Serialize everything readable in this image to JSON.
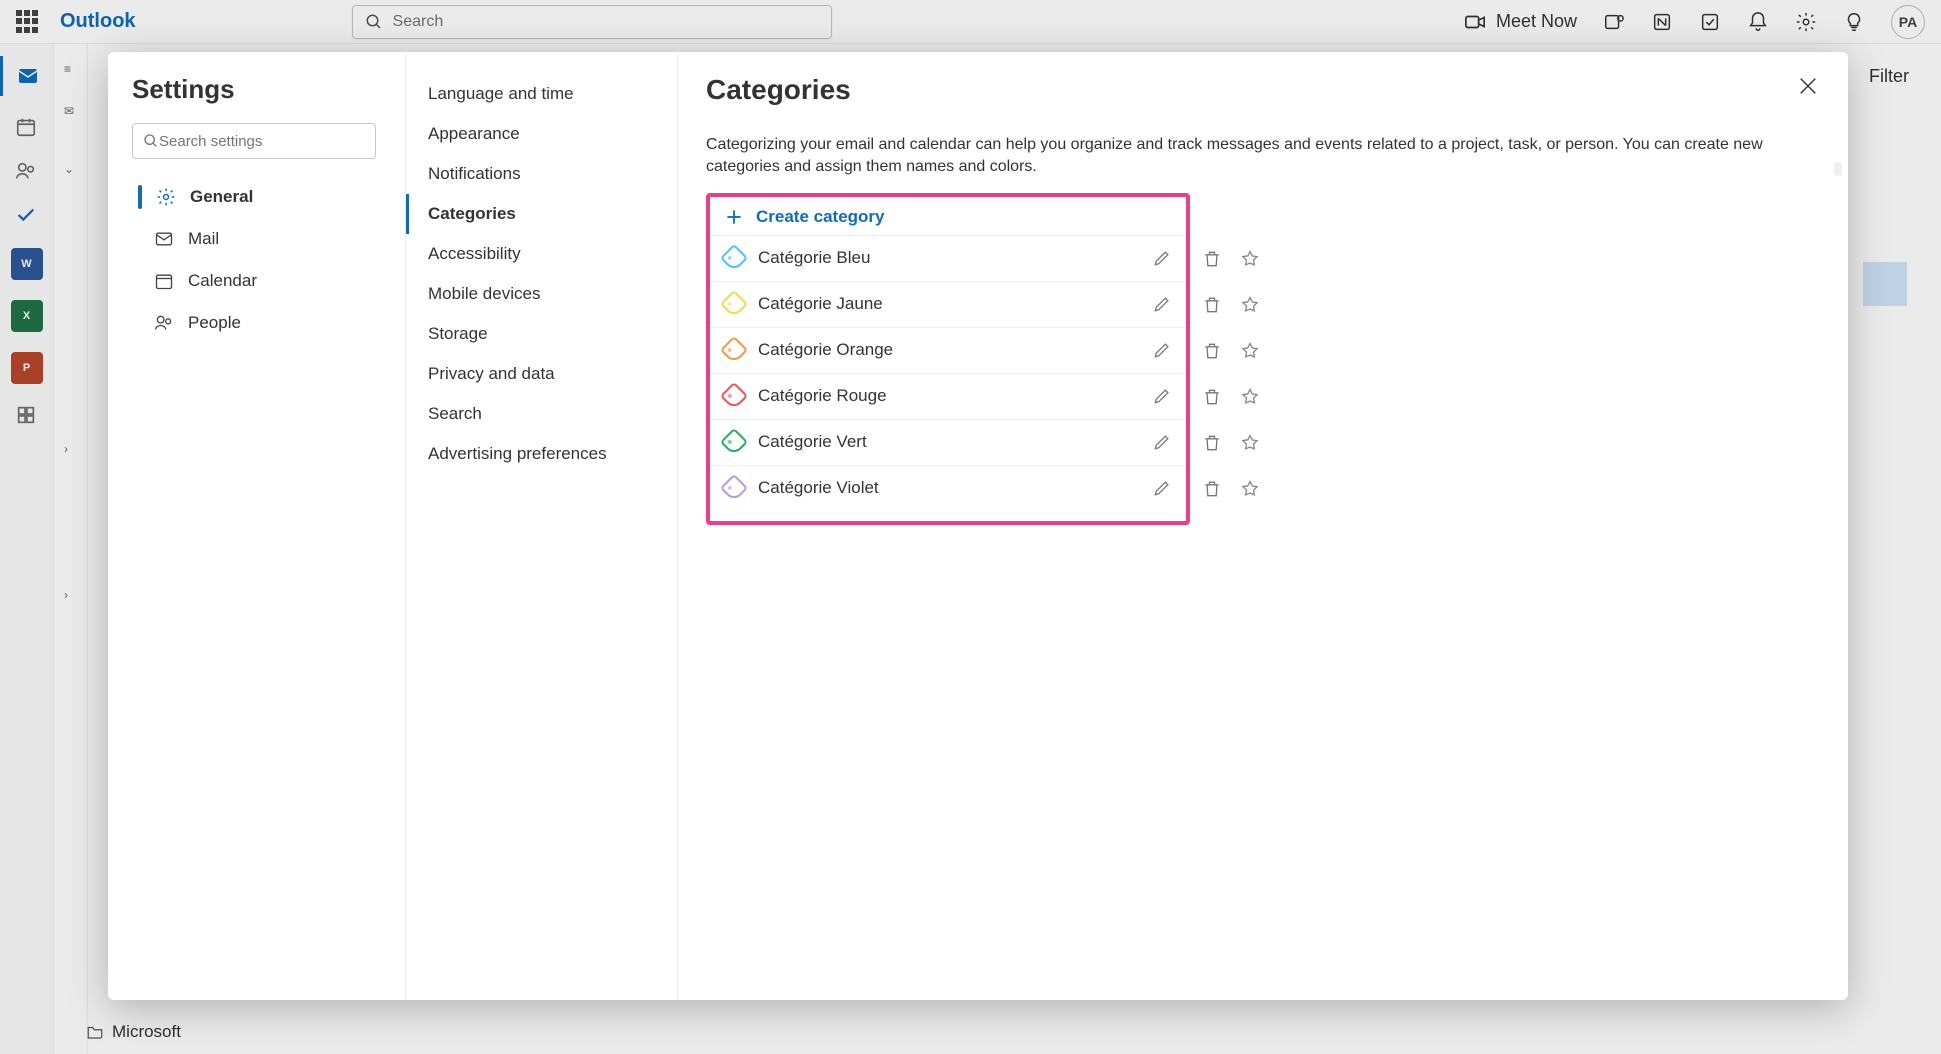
{
  "topbar": {
    "brand": "Outlook",
    "search_placeholder": "Search",
    "meet_now": "Meet Now",
    "avatar": "PA"
  },
  "mailbg": {
    "filter": "Filter",
    "folder_microsoft": "Microsoft"
  },
  "settings": {
    "title": "Settings",
    "search_placeholder": "Search settings",
    "nav": [
      {
        "key": "general",
        "label": "General",
        "icon": "gear"
      },
      {
        "key": "mail",
        "label": "Mail",
        "icon": "mail"
      },
      {
        "key": "calendar",
        "label": "Calendar",
        "icon": "calendar"
      },
      {
        "key": "people",
        "label": "People",
        "icon": "people"
      }
    ],
    "nav_active": "general",
    "subnav": [
      "Language and time",
      "Appearance",
      "Notifications",
      "Categories",
      "Accessibility",
      "Mobile devices",
      "Storage",
      "Privacy and data",
      "Search",
      "Advertising preferences"
    ],
    "subnav_active": "Categories"
  },
  "panel": {
    "heading": "Categories",
    "description": "Categorizing your email and calendar can help you organize and track messages and events related to a project, task, or person. You can create new categories and assign them names and colors.",
    "create_label": "Create category",
    "categories": [
      {
        "name": "Catégorie Bleu",
        "color_class": "c-blue"
      },
      {
        "name": "Catégorie Jaune",
        "color_class": "c-yellow"
      },
      {
        "name": "Catégorie Orange",
        "color_class": "c-orange"
      },
      {
        "name": "Catégorie Rouge",
        "color_class": "c-red"
      },
      {
        "name": "Catégorie Vert",
        "color_class": "c-green"
      },
      {
        "name": "Catégorie Violet",
        "color_class": "c-violet"
      }
    ]
  }
}
